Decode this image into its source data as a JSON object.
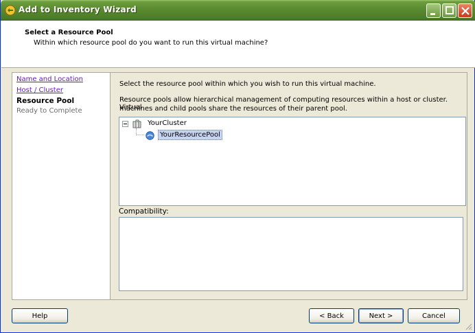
{
  "window": {
    "title": "Add to Inventory Wizard"
  },
  "header": {
    "title": "Select a Resource Pool",
    "subtitle": "Within which resource pool do you want to run this virtual machine?"
  },
  "steps": [
    {
      "label": "Name and Location",
      "state": "link"
    },
    {
      "label": "Host / Cluster",
      "state": "link"
    },
    {
      "label": "Resource Pool",
      "state": "current"
    },
    {
      "label": "Ready to Complete",
      "state": "pending"
    }
  ],
  "content": {
    "intro": "Select the resource pool within which you wish to run this virtual machine.",
    "description_line1": "Resource pools allow hierarchical management of computing resources within a host or cluster. Virtual",
    "description_line2": "machines and child pools share the resources of their parent pool.",
    "tree": {
      "cluster": "YourCluster",
      "pool": "YourResourcePool"
    },
    "compatibility_label": "Compatibility:"
  },
  "buttons": {
    "help": "Help",
    "back": "< Back",
    "next": "Next >",
    "cancel": "Cancel"
  },
  "colors": {
    "titlebar": "#5a8a30",
    "link": "#6a16c4",
    "selection": "#c6d3f1"
  }
}
